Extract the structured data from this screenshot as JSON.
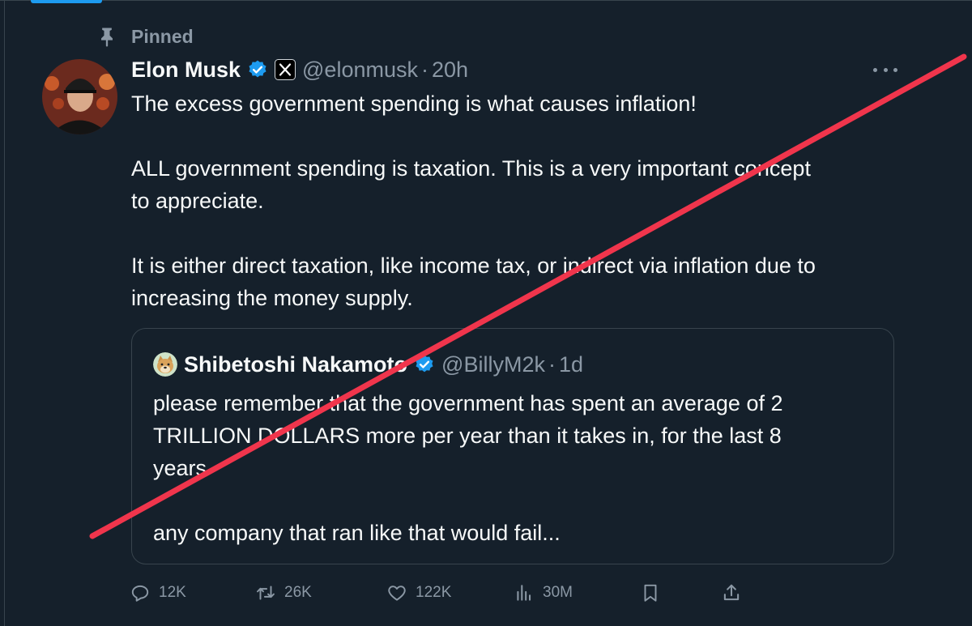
{
  "pinned_label": "Pinned",
  "tweet": {
    "author_name": "Elon Musk",
    "author_handle": "@elonmusk",
    "separator": "·",
    "time": "20h",
    "paragraphs": [
      [
        "The excess government spending is what causes inflation!"
      ],
      [
        "ALL government spending is taxation. This is a very important concept",
        "to appreciate."
      ],
      [
        "It is either direct taxation, like income tax, or indirect via inflation due to",
        "increasing the money supply."
      ]
    ]
  },
  "quote": {
    "author_name": "Shibetoshi Nakamoto",
    "author_handle": "@BillyM2k",
    "separator": "·",
    "time": "1d",
    "paragraphs": [
      [
        "please remember that the government has spent an average of 2",
        "TRILLION DOLLARS more per year than it takes in, for the last 8",
        "years"
      ],
      [
        "any company that ran like that would fail..."
      ]
    ]
  },
  "actions": {
    "replies": "12K",
    "reposts": "26K",
    "likes": "122K",
    "views": "30M"
  },
  "colors": {
    "background": "#15202b",
    "text_primary": "#f7f9f9",
    "text_secondary": "#8b98a5",
    "verified": "#1d9bf0",
    "border": "#38444d",
    "strike": "#f0354c"
  },
  "icons": {
    "pin": "pin-icon",
    "verified": "verified-badge-icon",
    "affiliation": "x-logo-icon",
    "more": "more-icon",
    "reply": "reply-icon",
    "repost": "repost-icon",
    "like": "heart-icon",
    "views": "views-icon",
    "bookmark": "bookmark-icon",
    "share": "share-icon"
  }
}
